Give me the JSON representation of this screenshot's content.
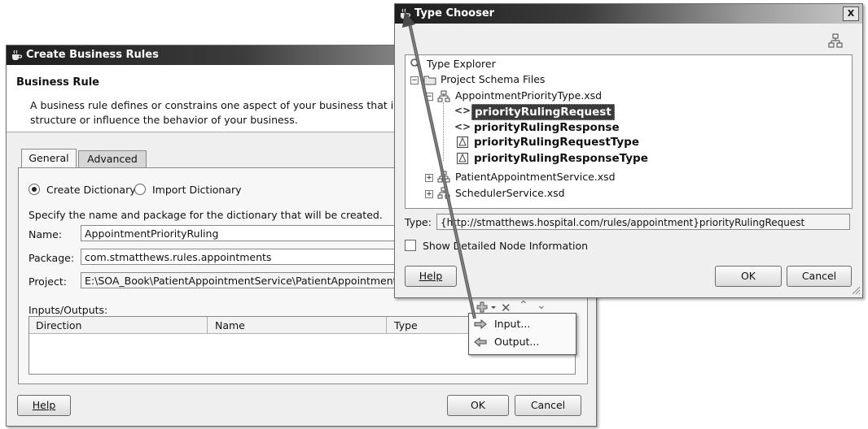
{
  "create_dialog": {
    "title": "Create Business Rules",
    "section_title": "Business Rule",
    "description_line1": "A business rule defines or constrains one aspect of your business that is inte",
    "description_line2": "structure or influence the behavior of your business.",
    "tabs": [
      "General",
      "Advanced"
    ],
    "radio_create": "Create Dictionary",
    "radio_import": "Import Dictionary",
    "instructions": "Specify the name and package for the dictionary that will be created.",
    "name_label": "Name:",
    "name_value": "AppointmentPriorityRuling",
    "package_label": "Package:",
    "package_value": "com.stmatthews.rules.appointments",
    "project_label": "Project:",
    "project_value": "E:\\SOA_Book\\PatientAppointmentService\\PatientAppointmentServ",
    "io_label": "Inputs/Outputs:",
    "table_headers": [
      "Direction",
      "Name",
      "Type"
    ],
    "help_label": "Help",
    "ok_label": "OK",
    "cancel_label": "Cancel"
  },
  "add_menu": {
    "items": [
      "Input...",
      "Output..."
    ]
  },
  "type_chooser": {
    "title": "Type Chooser",
    "close_symbol": "X",
    "tree": {
      "root": "Type Explorer",
      "project_schema": "Project Schema Files",
      "xsd1": "AppointmentPriorityType.xsd",
      "children": [
        "priorityRulingRequest",
        "priorityRulingResponse",
        "priorityRulingRequestType",
        "priorityRulingResponseType"
      ],
      "xsd2": "PatientAppointmentService.xsd",
      "xsd3": "SchedulerService.xsd"
    },
    "type_label": "Type:",
    "type_value": "{http://stmatthews.hospital.com/rules/appointment}priorityRulingRequest",
    "show_detail": "Show Detailed Node Information",
    "help_label": "Help",
    "ok_label": "OK",
    "cancel_label": "Cancel"
  },
  "colors": {
    "title_dark": "#1e1e1e",
    "selected_bg": "#3a3a3a",
    "window_bg": "#efefef"
  }
}
